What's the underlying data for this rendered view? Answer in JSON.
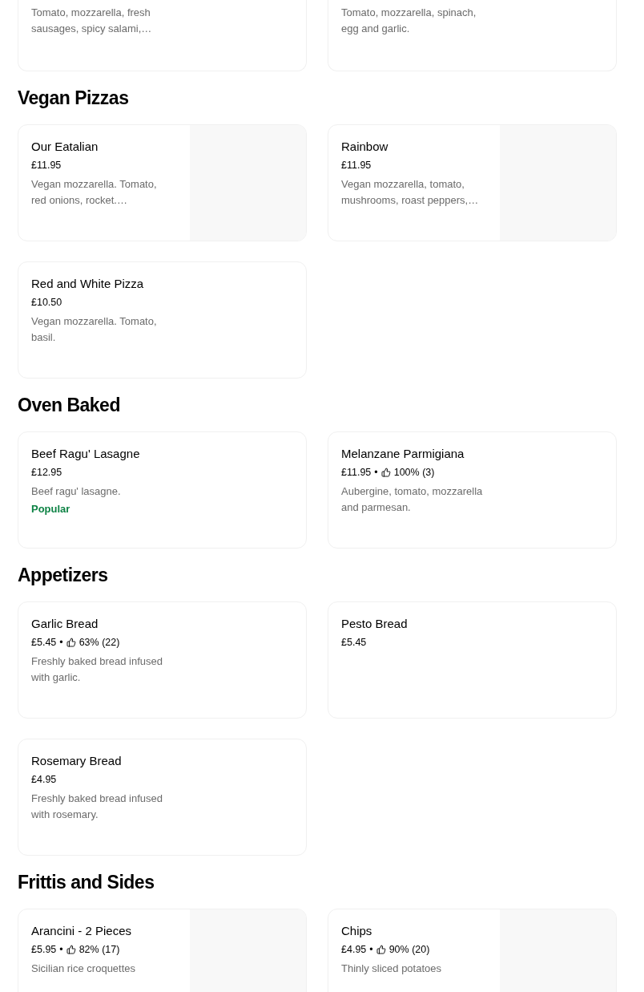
{
  "sections": [
    {
      "items": [
        {
          "description": "Tomato, mozzarella, fresh sausages, spicy salami,…"
        },
        {
          "description": "Tomato, mozzarella, spinach, egg and garlic."
        }
      ]
    },
    {
      "title": "Vegan Pizzas",
      "items": [
        {
          "name": "Our Eatalian",
          "price": "£11.95",
          "description": "Vegan mozzarella. Tomato, red onions, rocket.…"
        },
        {
          "name": "Rainbow",
          "price": "£11.95",
          "description": "Vegan mozzarella, tomato, mushrooms, roast peppers,…"
        },
        {
          "name": "Red and White Pizza",
          "price": "£10.50",
          "description": "Vegan mozzarella. Tomato, basil."
        }
      ]
    },
    {
      "title": "Oven Baked",
      "items": [
        {
          "name": "Beef Ragu' Lasagne",
          "price": "£12.95",
          "description": "Beef ragu' lasagne.",
          "badge": "Popular"
        },
        {
          "name": "Melanzane Parmigiana",
          "price": "£11.95",
          "separator": "•",
          "rating": "100% (3)",
          "description": "Aubergine, tomato, mozzarella and parmesan."
        }
      ]
    },
    {
      "title": "Appetizers",
      "items": [
        {
          "name": "Garlic Bread",
          "price": "£5.45",
          "separator": "•",
          "rating": "63% (22)",
          "description": "Freshly baked bread infused with garlic."
        },
        {
          "name": "Pesto Bread",
          "price": "£5.45"
        },
        {
          "name": "Rosemary Bread",
          "price": "£4.95",
          "description": "Freshly baked bread infused with rosemary."
        }
      ]
    },
    {
      "title": "Frittis and Sides",
      "items": [
        {
          "name": "Arancini - 2 Pieces",
          "price": "£5.95",
          "separator": "•",
          "rating": "82% (17)",
          "description": "Sicilian rice croquettes"
        },
        {
          "name": "Chips",
          "price": "£4.95",
          "separator": "•",
          "rating": "90% (20)",
          "description": "Thinly sliced potatoes"
        }
      ]
    }
  ]
}
